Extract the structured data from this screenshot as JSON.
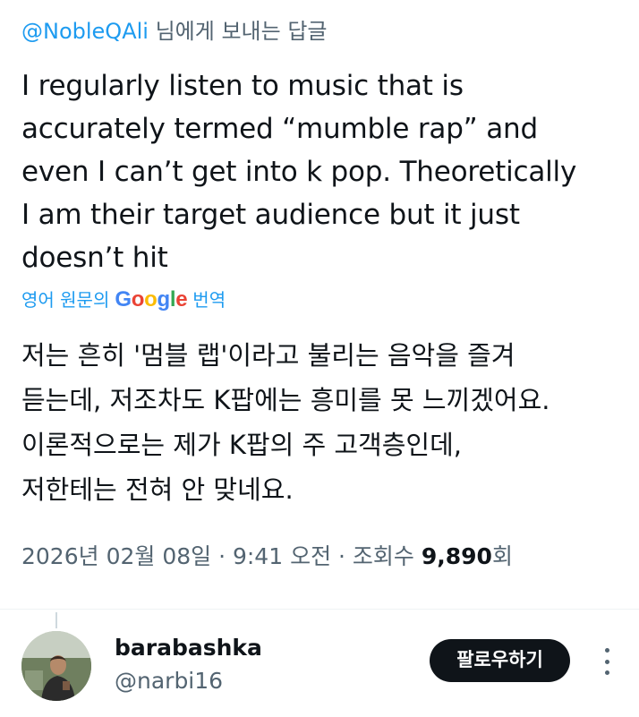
{
  "reply_to": {
    "handle": "@NobleQAli",
    "suffix": " 님에게 보내는 답글"
  },
  "tweet": {
    "lines": [
      "I regularly listen to music that is",
      "accurately termed “mumble rap” and",
      "even I can’t get into k pop. Theoretically",
      "I am their target audience but it just",
      "doesn’t hit"
    ]
  },
  "translation": {
    "from_label": "영어 원문의",
    "provider_letters": [
      "G",
      "o",
      "o",
      "g",
      "l",
      "e"
    ],
    "translate_label": "번역",
    "lines": [
      "저는 흔히 '멈블 랩'이라고 불리는 음악을 즐겨",
      "듣는데, 저조차도 K팝에는 흥미를 못 느끼겠어요.",
      "이론적으로는 제가 K팝의 주 고객층인데,",
      "저한테는 전혀 안 맞네요."
    ]
  },
  "meta": {
    "timestamp": "2026년 02월 08일 · 9:41 오전 · 조회수 ",
    "views": "9,890",
    "views_suffix": "회"
  },
  "next_user": {
    "name": "barabashka",
    "handle": "@narbi16",
    "follow_label": "팔로우하기"
  },
  "icons": {
    "more": "more-vertical-icon",
    "avatar": "avatar-photo"
  },
  "colors": {
    "link": "#1d9bf0",
    "secondary_text": "#536471",
    "primary_text": "#0f1419",
    "button_bg": "#0f1419"
  }
}
